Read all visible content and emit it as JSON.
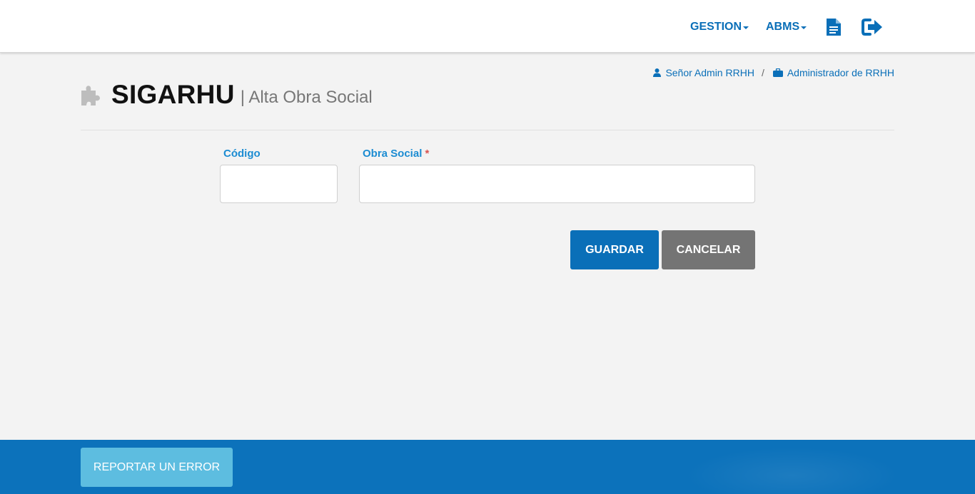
{
  "nav": {
    "items": [
      {
        "label": "GESTION"
      },
      {
        "label": "ABMS"
      }
    ],
    "document_icon": "document-icon",
    "logout_icon": "sign-out-icon"
  },
  "user": {
    "name": "Señor Admin RRHH",
    "separator": "/",
    "role": "Administrador de RRHH"
  },
  "header": {
    "title": "SIGARHU",
    "subtitle": "| Alta Obra Social"
  },
  "form": {
    "codigo_label": "Código",
    "codigo_value": "",
    "obra_social_label": "Obra Social",
    "required_mark": "*",
    "obra_social_value": ""
  },
  "buttons": {
    "save": "GUARDAR",
    "cancel": "CANCELAR"
  },
  "footer": {
    "report_label": "REPORTAR UN ERROR"
  },
  "colors": {
    "primary": "#0a6fb8",
    "label": "#1c8cd2",
    "cancel": "#747474",
    "report": "#5dbde0",
    "required": "#d9534f"
  }
}
